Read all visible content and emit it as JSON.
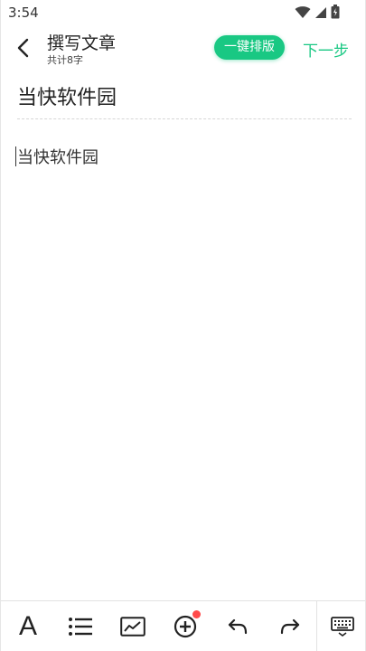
{
  "status_bar": {
    "time": "3:54",
    "icons": [
      "wifi-icon",
      "signal-icon",
      "battery-icon"
    ]
  },
  "header": {
    "title": "撰写文章",
    "subtitle": "共计8字",
    "format_button_label": "一键排版",
    "next_button_label": "下一步",
    "back_icon": "back-arrow-icon"
  },
  "editor": {
    "title": "当快软件园",
    "body": "当快软件园"
  },
  "toolbar": {
    "font_label": "A",
    "items": [
      "font-icon",
      "list-icon",
      "image-icon",
      "insert-icon",
      "undo-icon",
      "redo-icon",
      "keyboard-icon"
    ]
  },
  "colors": {
    "accent": "#19c883",
    "text": "#222222",
    "badge": "#ff4a4a"
  }
}
